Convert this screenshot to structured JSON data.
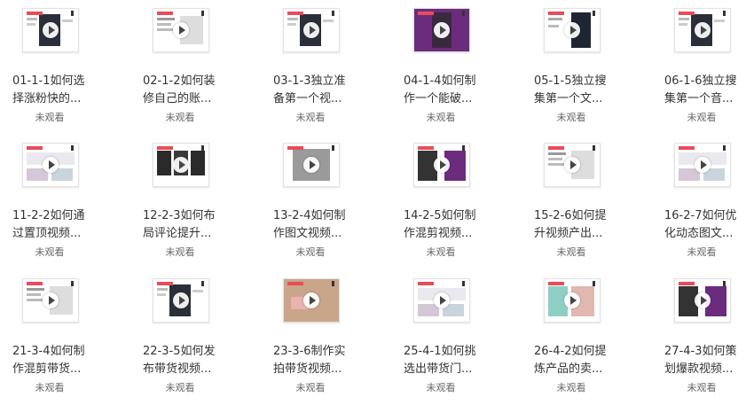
{
  "videos": [
    {
      "title": "01-1-1如何选择涨粉快的...",
      "status": "未观看",
      "thumb": "phone-dark"
    },
    {
      "title": "02-1-2如何装修自己的账...",
      "status": "未观看",
      "thumb": "doc-light"
    },
    {
      "title": "03-1-3独立准备第一个视...",
      "status": "未观看",
      "thumb": "phone-dark"
    },
    {
      "title": "04-1-4如何制作一个能破...",
      "status": "未观看",
      "thumb": "purple"
    },
    {
      "title": "05-1-5独立搜集第一个文...",
      "status": "未观看",
      "thumb": "moon"
    },
    {
      "title": "06-1-6独立搜集第一个音...",
      "status": "未观看",
      "thumb": "phone-dark"
    },
    {
      "title": "11-2-2如何通过置顶视频...",
      "status": "未观看",
      "thumb": "grid-light"
    },
    {
      "title": "12-2-3如何布局评论提升...",
      "status": "未观看",
      "thumb": "dark-columns"
    },
    {
      "title": "13-2-4如何制作图文视频...",
      "status": "未观看",
      "thumb": "photo"
    },
    {
      "title": "14-2-5如何制作混剪视频...",
      "status": "未观看",
      "thumb": "purple-list"
    },
    {
      "title": "15-2-6如何提升视频产出...",
      "status": "未观看",
      "thumb": "doc-light"
    },
    {
      "title": "16-2-7如何优化动态图文...",
      "status": "未观看",
      "thumb": "grid-light"
    },
    {
      "title": "21-3-4如何制作混剪带货...",
      "status": "未观看",
      "thumb": "doc-light"
    },
    {
      "title": "22-3-5如何发布带货视频...",
      "status": "未观看",
      "thumb": "phone-dark"
    },
    {
      "title": "23-3-6制作实拍带货视频...",
      "status": "未观看",
      "thumb": "box-photo"
    },
    {
      "title": "25-4-1如何挑选出带货门...",
      "status": "未观看",
      "thumb": "grid-light"
    },
    {
      "title": "26-4-2如何提炼产品的卖...",
      "status": "未观看",
      "thumb": "product"
    },
    {
      "title": "27-4-3如何策划爆款视频...",
      "status": "未观看",
      "thumb": "purple-list"
    }
  ],
  "colors": {
    "accent": "#e84c5a",
    "purple": "#6b2c7e",
    "text": "#333333",
    "muted": "#666666"
  }
}
